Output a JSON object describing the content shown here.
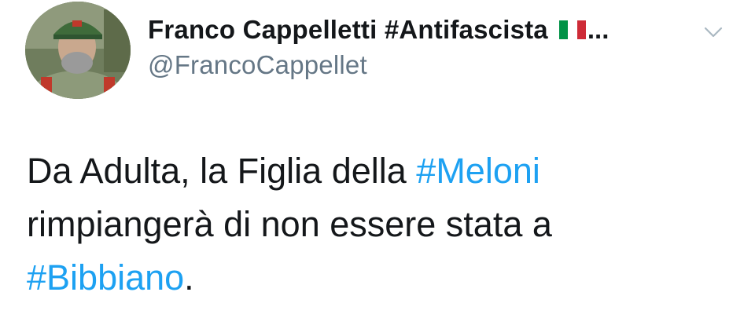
{
  "tweet": {
    "display_name": "Franco Cappelletti #Antifascista",
    "flag": "italian-flag",
    "name_ellipsis": "...",
    "handle": "@FrancoCappellet",
    "body": {
      "line1_text": "Da Adulta, la Figlia della ",
      "hashtag1": "#Meloni",
      "line2_text": "rimpiangerà di non essere stata a",
      "hashtag2": "#Bibbiano",
      "end_punct": "."
    }
  },
  "icons": {
    "menu": "chevron-down-icon"
  },
  "colors": {
    "text": "#14171a",
    "secondary": "#657786",
    "hashtag": "#1da1f2",
    "flag_green": "#009246",
    "flag_white": "#ffffff",
    "flag_red": "#ce2b37"
  }
}
